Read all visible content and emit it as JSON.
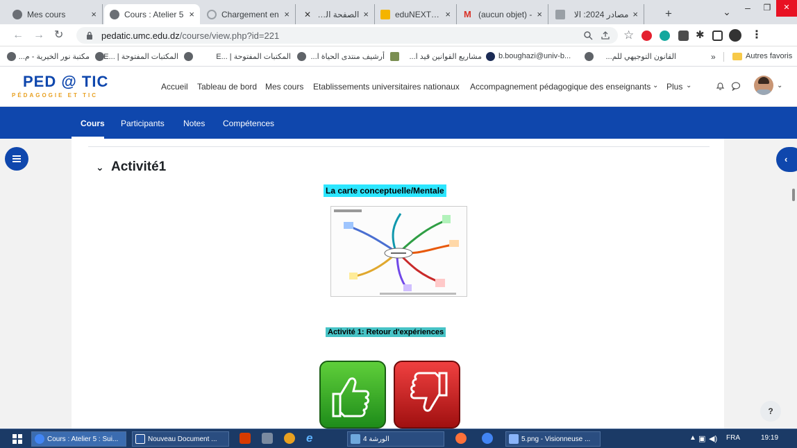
{
  "tabs": [
    {
      "title": "Mes cours",
      "close": "×"
    },
    {
      "title": "Cours : Atelier 5",
      "close": "×"
    },
    {
      "title": "Chargement en",
      "close": "×"
    },
    {
      "title": "الصفحة الرئيسية",
      "close": "×"
    },
    {
      "title": "eduNEXT | Man",
      "close": "×"
    },
    {
      "title": "(aucun objet) - ",
      "close": "×"
    },
    {
      "title": "مصادر 2024: الا",
      "close": "×"
    }
  ],
  "new_tab": "+",
  "window": {
    "tab_menu": "⌄",
    "minimize": "–",
    "maximize": "❐",
    "close": "✕"
  },
  "address_bar": {
    "domain": "pedatic.umc.edu.dz",
    "path": "/course/view.php?id=221"
  },
  "bookmarks": {
    "items": [
      "مكتبة نور الخيرية - م...",
      "المكتبات المفتوحة | ...E",
      "المكتبات المفتوحة | ...E",
      "أرشيف منتدى الحياة ا...",
      "مشاريع القوانين قيد ا...",
      "b.boughazi@univ-b...",
      "القانون التوجيهي للم..."
    ],
    "overflow": "»",
    "other": "Autres favoris"
  },
  "site": {
    "logo_main": "PED @ TIC",
    "logo_sub": "PÉDAGOGIE ET TIC",
    "nav": [
      "Accueil",
      "Tableau de bord",
      "Mes cours",
      "Etablissements universitaires nationaux",
      "Accompagnement pédagogique des enseignants",
      "Plus"
    ],
    "secondary_nav": [
      "Cours",
      "Participants",
      "Notes",
      "Compétences"
    ]
  },
  "section": {
    "title": "Activité1",
    "map_heading": "La carte conceptuelle/Mentale",
    "activity_heading": "Activité 1: Retour d'expériences"
  },
  "help": "?",
  "taskbar": {
    "items": [
      "Cours : Atelier 5 : Sui...",
      "Nouveau Document ...",
      "الورشة 4",
      "5.png - Visionneuse ..."
    ],
    "lang": "FRA",
    "time": "19:19"
  },
  "colors": {
    "brand": "#0f47ad",
    "logo_accent": "#e8a020",
    "heading_highlight": "#2ce6ff",
    "activity_highlight": "#47c3c6"
  }
}
